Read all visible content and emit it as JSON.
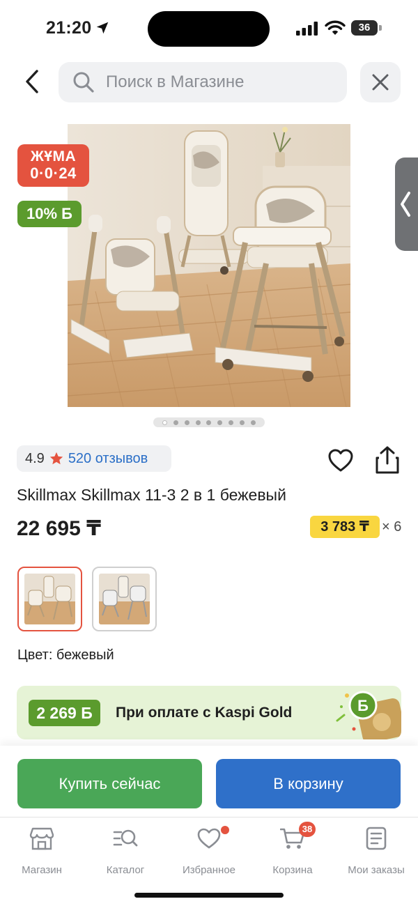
{
  "status_bar": {
    "time": "21:20",
    "battery": "36"
  },
  "search": {
    "placeholder": "Поиск в Магазине"
  },
  "badges": {
    "promo_line1": "ЖҰМА",
    "promo_line2": "0·0·24",
    "bonus": "10% Б"
  },
  "gallery": {
    "total_images": 9,
    "active_index": 0
  },
  "rating": {
    "value": "4.9",
    "reviews": "520 отзывов"
  },
  "product": {
    "title": "Skillmax Skillmax 11-3 2 в 1 бежевый",
    "price": "22 695 ₸",
    "installment_amount": "3 783 ₸",
    "installment_months": "× 6",
    "color_label": "Цвет: бежевый",
    "selected_variant_index": 0
  },
  "kaspi_gold": {
    "amount": "2 269 Б",
    "text": "При оплате с Kaspi Gold"
  },
  "actions": {
    "buy_now": "Купить сейчас",
    "add_to_cart": "В корзину"
  },
  "tabs": [
    {
      "label": "Магазин",
      "icon": "shop-icon"
    },
    {
      "label": "Каталог",
      "icon": "catalog-search-icon"
    },
    {
      "label": "Избранное",
      "icon": "heart-icon",
      "has_dot": true
    },
    {
      "label": "Корзина",
      "icon": "cart-icon",
      "badge": "38"
    },
    {
      "label": "Мои заказы",
      "icon": "orders-icon"
    }
  ],
  "colors": {
    "accent_red": "#e4533f",
    "accent_green": "#5b9b2d",
    "buy_green": "#4aa757",
    "cart_blue": "#2f70c9",
    "installment_yellow": "#f9d640",
    "link_blue": "#2b6fc7"
  }
}
